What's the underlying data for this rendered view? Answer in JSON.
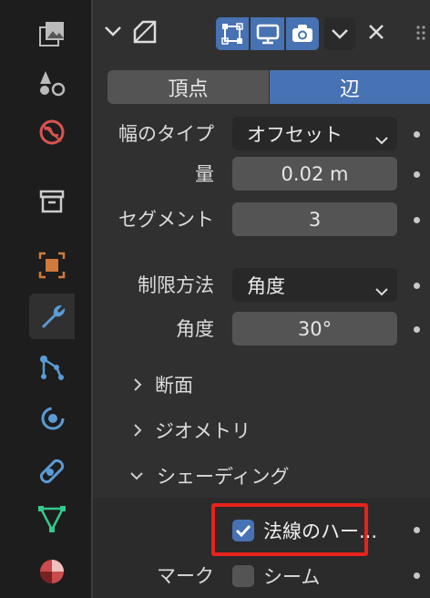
{
  "header": {
    "collapse_icon": "chevron-down-icon",
    "modifier_icon": "bevel-modifier-icon",
    "toggles": [
      "edit-mode-icon",
      "viewport-display-icon",
      "render-camera-icon"
    ],
    "menu_icon": "chevron-down-icon",
    "close_icon": "close-icon"
  },
  "affect": {
    "vertices": "頂点",
    "edges": "辺",
    "selected": "辺"
  },
  "props": {
    "width_type_label": "幅のタイプ",
    "width_type_value": "オフセット",
    "amount_label": "量",
    "amount_value": "0.02 m",
    "segments_label": "セグメント",
    "segments_value": "3",
    "limit_label": "制限方法",
    "limit_value": "角度",
    "angle_label": "角度",
    "angle_value": "30°"
  },
  "subpanels": {
    "profile": "断面",
    "geometry": "ジオメトリ",
    "shading": "シェーディング"
  },
  "shading": {
    "harden_normals_label": "法線のハー...",
    "harden_normals_checked": true,
    "mark_label": "マーク",
    "seam_label": "シーム",
    "seam_checked": false
  },
  "sidebar_tabs": [
    "image-icon",
    "physics-icon",
    "world-icon",
    "collection-icon",
    "object-icon",
    "wrench-icon",
    "particles-icon",
    "physics-orbit-icon",
    "constraint-icon",
    "data-icon",
    "material-icon"
  ],
  "colors": {
    "accent": "#4772b3",
    "highlight_box": "#e8231b",
    "panel": "#303030"
  }
}
